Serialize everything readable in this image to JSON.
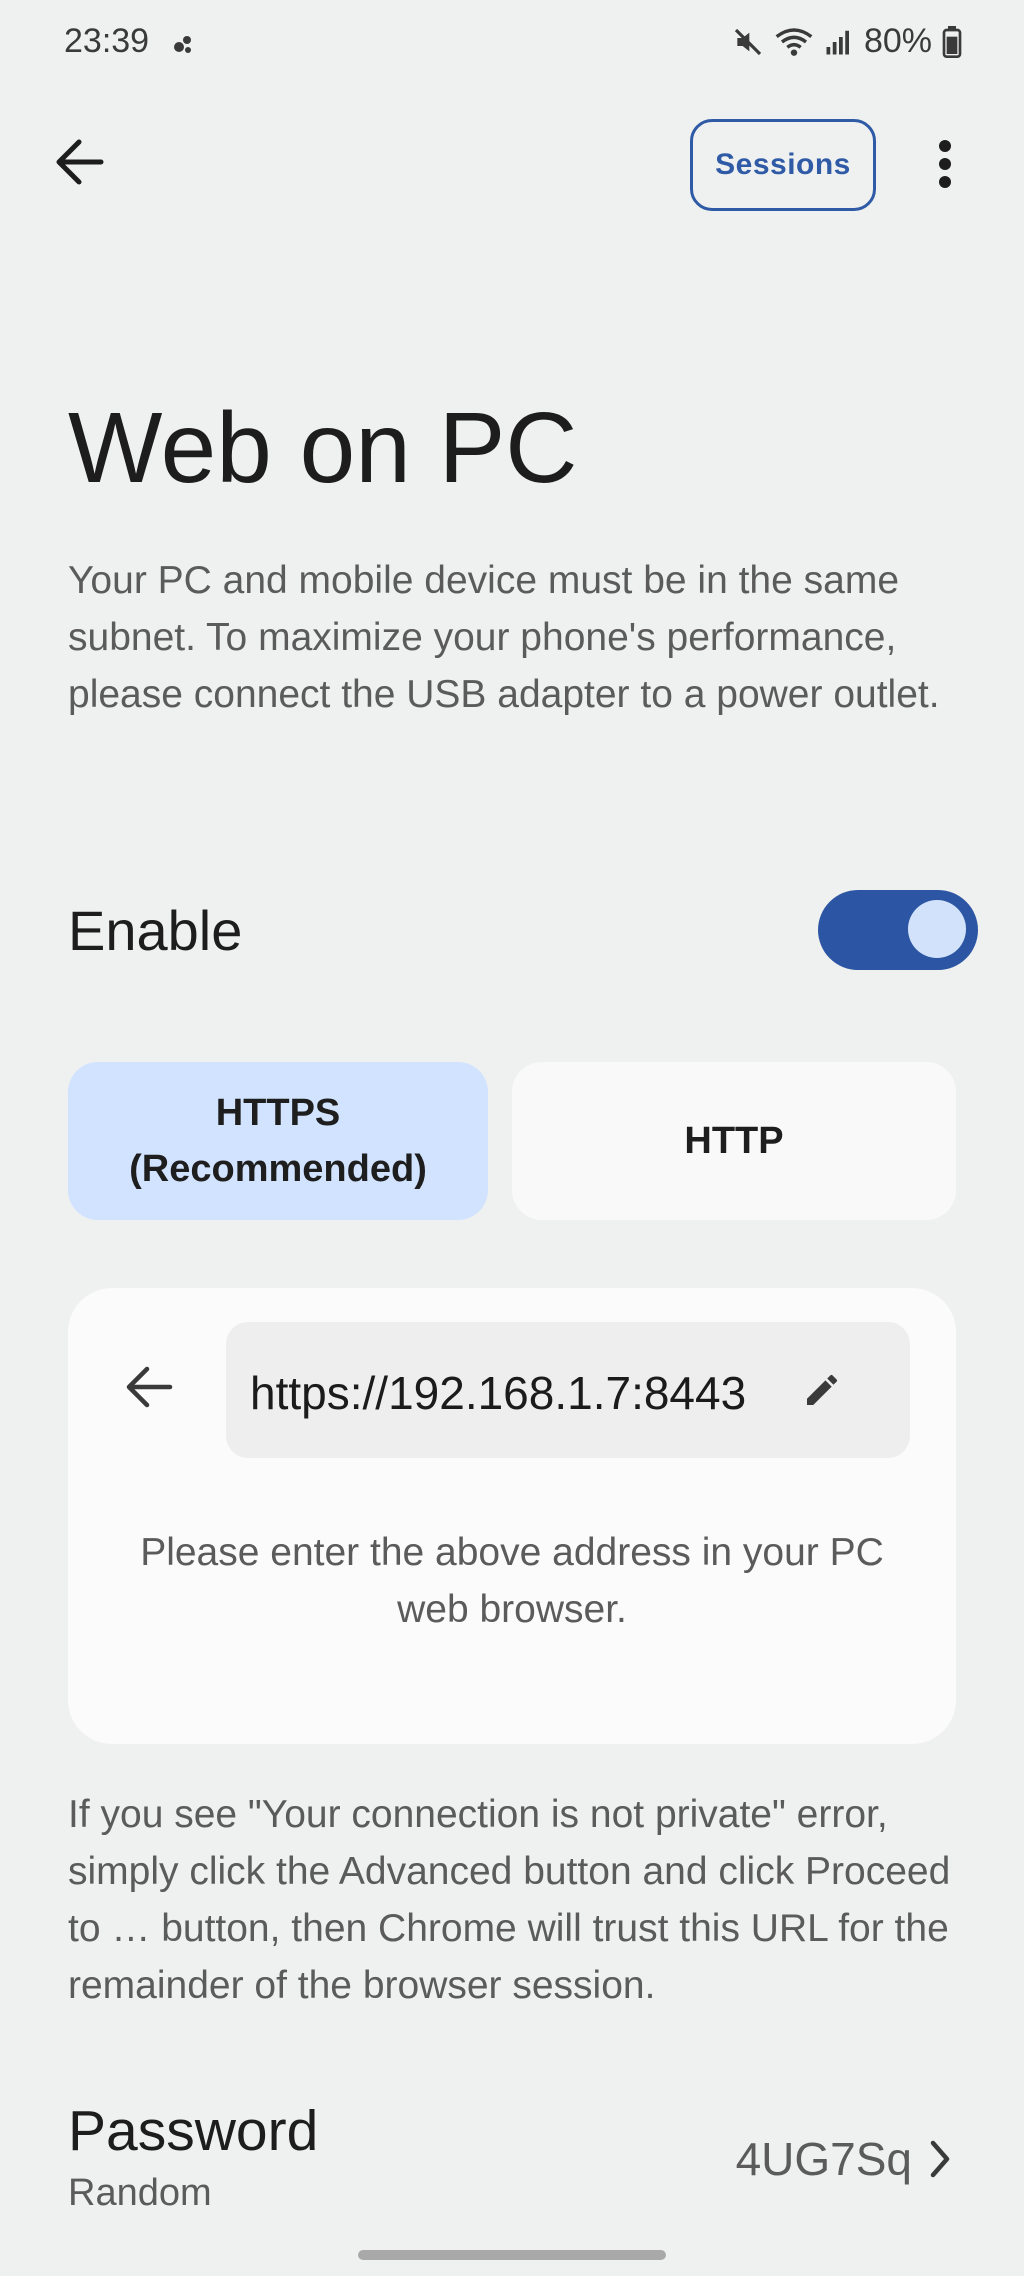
{
  "status_bar": {
    "time": "23:39",
    "battery": "80%",
    "icons": [
      "dot-icon",
      "mute-icon",
      "wifi-icon",
      "signal-icon",
      "battery-icon"
    ]
  },
  "top_bar": {
    "back_icon": "arrow-back-icon",
    "sessions_label": "Sessions",
    "more_icon": "more-vert-icon"
  },
  "title": "Web on PC",
  "intro": "Your PC and mobile device must be in the same subnet. To maximize your phone's performance, please connect the USB adapter to a power outlet.",
  "enable": {
    "label": "Enable",
    "on": true,
    "accent": "#2c56a3"
  },
  "protocol": {
    "https_line1": "HTTPS",
    "https_line2": "(Recommended)",
    "http_label": "HTTP",
    "selected": "HTTPS",
    "selected_color": "#d1e3ff"
  },
  "address_card": {
    "url": "https://192.168.1.7:8443",
    "hint": "Please enter the above address in your PC web browser."
  },
  "note": "If you see \"Your connection is not private\" error, simply click the Advanced button and click Proceed to … button, then Chrome will trust this URL for the remainder of the browser session.",
  "password": {
    "label": "Password",
    "sub": "Random",
    "value": "4UG7Sq"
  }
}
